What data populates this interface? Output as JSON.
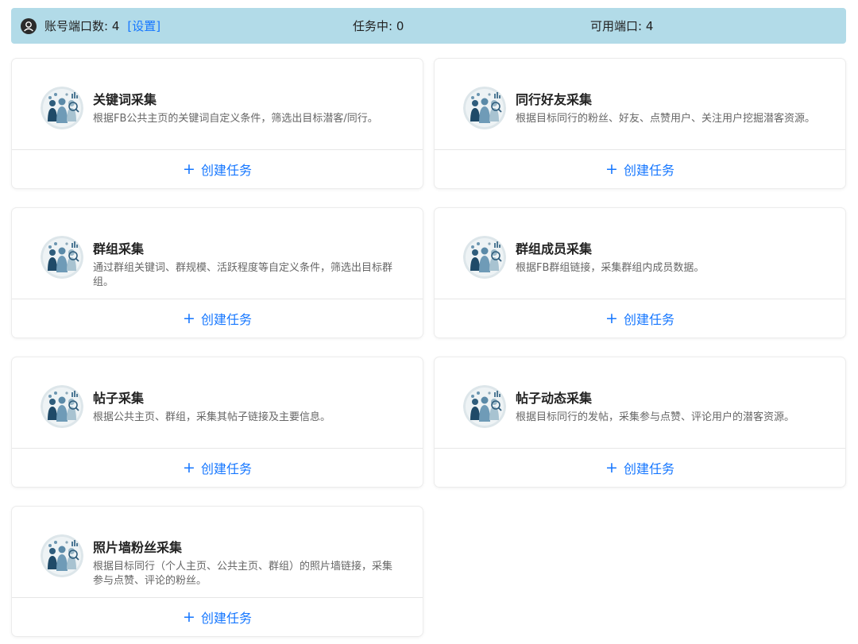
{
  "status_bar": {
    "account_ports_label": "账号端口数: 4",
    "settings_link": "[设置]",
    "tasks_label": "任务中: 0",
    "available_ports_label": "可用端口: 4"
  },
  "cards": [
    {
      "title": "关键词采集",
      "description": "根据FB公共主页的关键词自定义条件，筛选出目标潜客/同行。",
      "action": "创建任务"
    },
    {
      "title": "同行好友采集",
      "description": "根据目标同行的粉丝、好友、点赞用户、关注用户挖掘潜客资源。",
      "action": "创建任务"
    },
    {
      "title": "群组采集",
      "description": "通过群组关键词、群规模、活跃程度等自定义条件，筛选出目标群组。",
      "action": "创建任务"
    },
    {
      "title": "群组成员采集",
      "description": "根据FB群组链接，采集群组内成员数据。",
      "action": "创建任务"
    },
    {
      "title": "帖子采集",
      "description": "根据公共主页、群组，采集其帖子链接及主要信息。",
      "action": "创建任务"
    },
    {
      "title": "帖子动态采集",
      "description": "根据目标同行的发帖，采集参与点赞、评论用户的潜客资源。",
      "action": "创建任务"
    },
    {
      "title": "照片墙粉丝采集",
      "description": "根据目标同行（个人主页、公共主页、群组）的照片墙链接，采集参与点赞、评论的粉丝。",
      "action": "创建任务"
    }
  ],
  "colors": {
    "status_bar_bg": "#b2dbe8",
    "link_blue": "#1677ff"
  },
  "icons": {
    "status": "user-circle-icon",
    "card": "people-collection-icon",
    "action": "plus-icon"
  }
}
